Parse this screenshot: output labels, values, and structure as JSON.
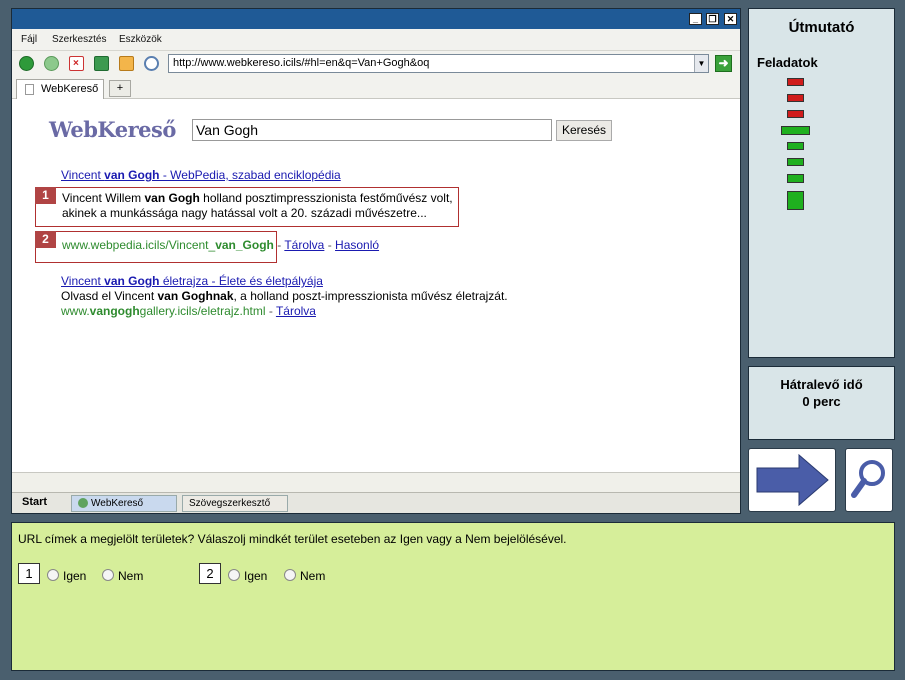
{
  "browser": {
    "window_controls": {
      "minimize": "_",
      "restore": "❐",
      "close": "✕"
    },
    "menu": [
      "Fájl",
      "Szerkesztés",
      "Eszközök"
    ],
    "address": "http://www.webkereso.icils/#hl=en&q=Van+Gogh&oq",
    "address_dropdown": "▼",
    "go": "➜",
    "tab_label": "WebKereső",
    "new_tab": "+"
  },
  "search": {
    "logo": "WebKereső",
    "query": "Van Gogh",
    "button": "Keresés"
  },
  "results": {
    "r1_title_a": "Vincent ",
    "r1_title_b": "van Gogh",
    "r1_title_c": " - WebPedia, szabad enciklopédia",
    "r1_snip_a": "Vincent Willem ",
    "r1_snip_b": "van Gogh",
    "r1_snip_c": " holland posztimpresszionista festőművész volt,",
    "r1_snip_line2": "akinek a munkássága nagy hatással volt a 20. századi művészetre...",
    "r1_url_a": "www.webpedia.icils/Vincent_",
    "r1_url_b": "van_Gogh",
    "r1_cache": "Tárolva",
    "r1_similar": "Hasonló",
    "r2_title_a": "Vincent ",
    "r2_title_b": "van Gogh",
    "r2_title_c": " életrajza - Élete és életpályája",
    "r2_snip_a": "Olvasd el Vincent ",
    "r2_snip_b": "van Goghnak",
    "r2_snip_c": ", a holland poszt-impresszionista művész életrajzát.",
    "r2_url_a": "www.",
    "r2_url_b": "vangogh",
    "r2_url_c": "gallery.icils/eletrajz.html",
    "r2_cache": "Tárolva",
    "sep": " - "
  },
  "marks": {
    "m1": "1",
    "m2": "2"
  },
  "taskbar": {
    "start": "Start",
    "items": [
      "WebKereső",
      "Szövegszerkesztő"
    ]
  },
  "guide": {
    "title": "Útmutató",
    "tasks_label": "Feladatok",
    "task_status": [
      "red",
      "red",
      "red",
      "green-current",
      "green",
      "green",
      "green",
      "green-large"
    ]
  },
  "timer": {
    "label": "Hátralevő idő",
    "value": "0 perc"
  },
  "nav_icons": [
    "back-icon",
    "forward-icon",
    "stop-icon",
    "refresh-icon",
    "home-icon",
    "search-icon"
  ],
  "colors": {
    "accent_red": "#b04444",
    "status_green": "#1fb01f",
    "status_red": "#d01c1c",
    "question_bg": "#d6ee9a"
  },
  "question": {
    "text": "URL címek a megjelölt területek? Válaszolj mindkét terület eseteben az Igen vagy a Nem bejelölésével.",
    "items": [
      {
        "num": "1",
        "yes": "Igen",
        "no": "Nem"
      },
      {
        "num": "2",
        "yes": "Igen",
        "no": "Nem"
      }
    ]
  }
}
